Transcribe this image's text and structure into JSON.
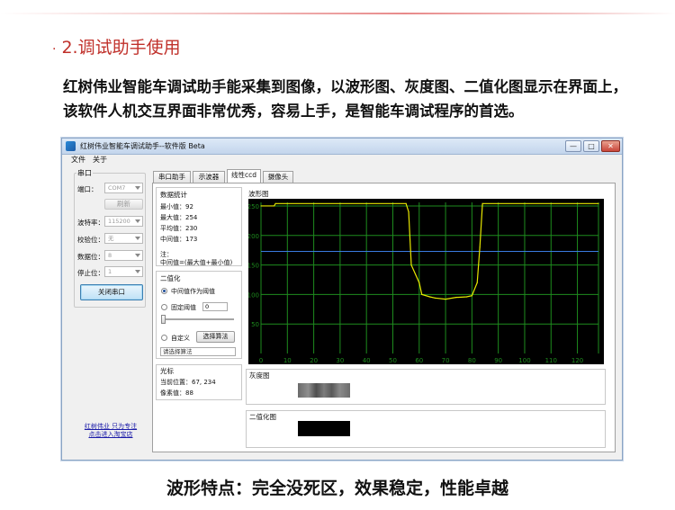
{
  "section": {
    "bullet": "·",
    "title": "2.调试助手使用"
  },
  "intro": "红树伟业智能车调试助手能采集到图像，以波形图、灰度图、二值化图显示在界面上，该软件人机交互界面非常优秀，容易上手，是智能车调试程序的首选。",
  "bottom_caption": "波形特点：完全没死区，效果稳定，性能卓越",
  "window": {
    "title": "红树伟业智能车调试助手--软件版 Beta",
    "controls": {
      "minimize": "—",
      "maximize": "□",
      "close": "✕"
    },
    "menu": [
      "文件",
      "关于"
    ]
  },
  "serial": {
    "group_label": "串口",
    "port_label": "端口：",
    "port_value": "COM7",
    "refresh_button": "刷新",
    "baud_label": "波特率：",
    "baud_value": "115200",
    "parity_label": "校验位：",
    "parity_value": "无",
    "databits_label": "数据位：",
    "databits_value": "8",
    "stopbits_label": "停止位：",
    "stopbits_value": "1",
    "close_button": "关闭串口",
    "link_line1": "红树伟业 只为专注",
    "link_line2": "点击进入淘宝店"
  },
  "tabs": [
    "串口助手",
    "示波器",
    "线性ccd",
    "摄像头"
  ],
  "active_tab": 2,
  "stats": {
    "title": "数据统计",
    "min_label": "最小值：",
    "min_value": "92",
    "max_label": "最大值：",
    "max_value": "254",
    "avg_label": "平均值：",
    "avg_value": "230",
    "mid_label": "中间值：",
    "mid_value": "173",
    "note_line1": "注：",
    "note_line2": "中间值=(最大值+最小值)"
  },
  "binarize": {
    "title": "二值化",
    "opt_mid": "中间值作为阈值",
    "opt_fixed": "固定阈值",
    "fixed_value": "0",
    "opt_custom": "自定义",
    "select_algo_button": "选择算法",
    "algo_placeholder": "请选择算法"
  },
  "cursor": {
    "title": "光标",
    "pos_label": "当前位置：",
    "pos_value": "67, 234",
    "pixel_label": "像素值：",
    "pixel_value": "88"
  },
  "waveform_title": "波形图",
  "gray_title": "灰度图",
  "binary_title": "二值化图",
  "colors": {
    "grid": "#1e8c1e",
    "trace": "#e8e800",
    "threshold": "#3a7be0",
    "chart_bg": "#000000"
  },
  "chart_data": {
    "type": "line",
    "title": "波形图",
    "xlim": [
      0,
      128
    ],
    "ylim": [
      0,
      256
    ],
    "xticks": [
      0,
      10,
      20,
      30,
      40,
      50,
      60,
      70,
      80,
      90,
      100,
      110,
      120
    ],
    "yticks": [
      50,
      100,
      150,
      200,
      250
    ],
    "threshold": 173,
    "x": [
      0,
      5,
      5.5,
      55,
      56,
      57,
      60,
      61,
      64,
      66,
      70,
      74,
      78,
      80,
      82,
      83,
      84,
      128
    ],
    "y": [
      250,
      250,
      254,
      254,
      240,
      150,
      120,
      100,
      96,
      94,
      92,
      95,
      96,
      98,
      120,
      180,
      254,
      254
    ]
  }
}
